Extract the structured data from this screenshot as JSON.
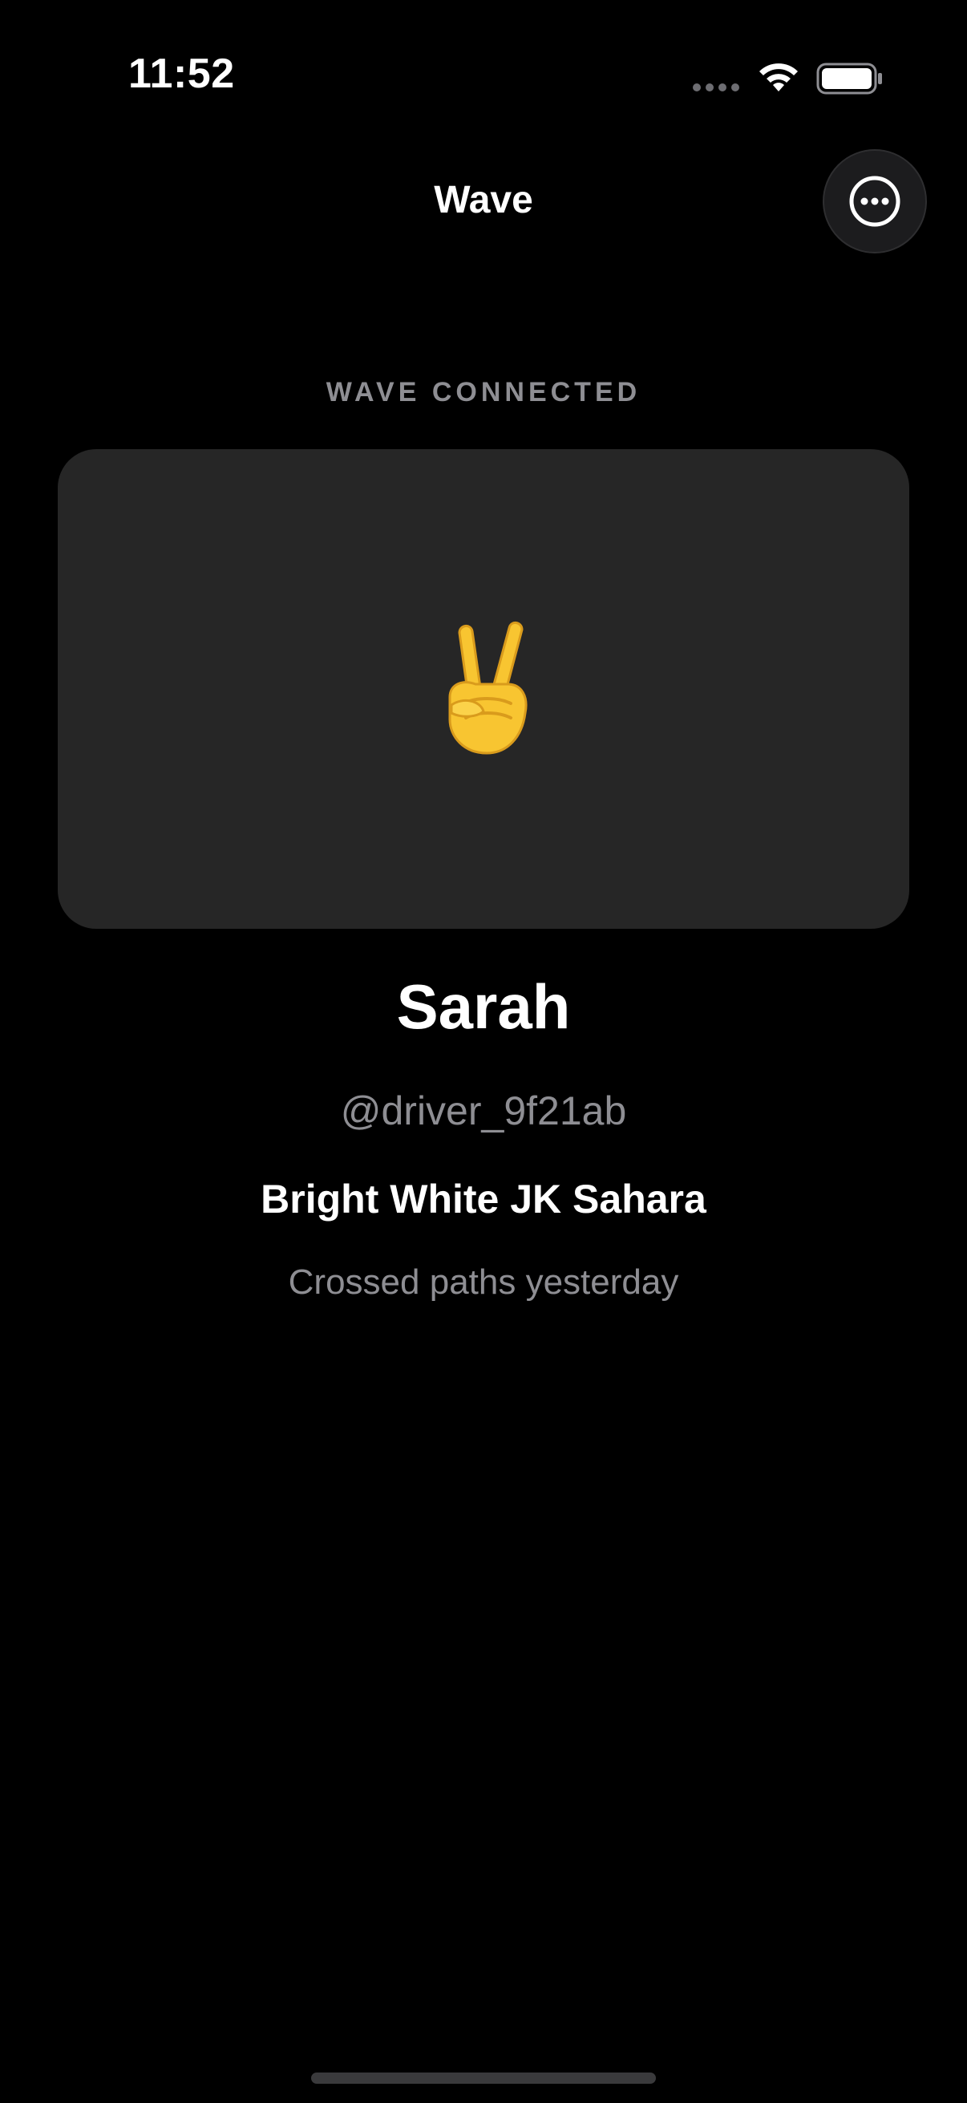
{
  "status_bar": {
    "time": "11:52",
    "icons": [
      "cellular-dots-icon",
      "wifi-icon",
      "battery-icon"
    ]
  },
  "nav": {
    "title": "Wave",
    "more_icon": "ellipsis-circle-icon"
  },
  "section_label": "WAVE CONNECTED",
  "card": {
    "emoji": "victory-hand-emoji",
    "background": "#262626"
  },
  "profile": {
    "name": "Sarah",
    "handle": "@driver_9f21ab",
    "vehicle": "Bright White JK Sahara",
    "met": "Crossed paths yesterday"
  },
  "colors": {
    "background": "#000000",
    "secondary_text": "#8e8e93",
    "primary_text": "#ffffff"
  }
}
